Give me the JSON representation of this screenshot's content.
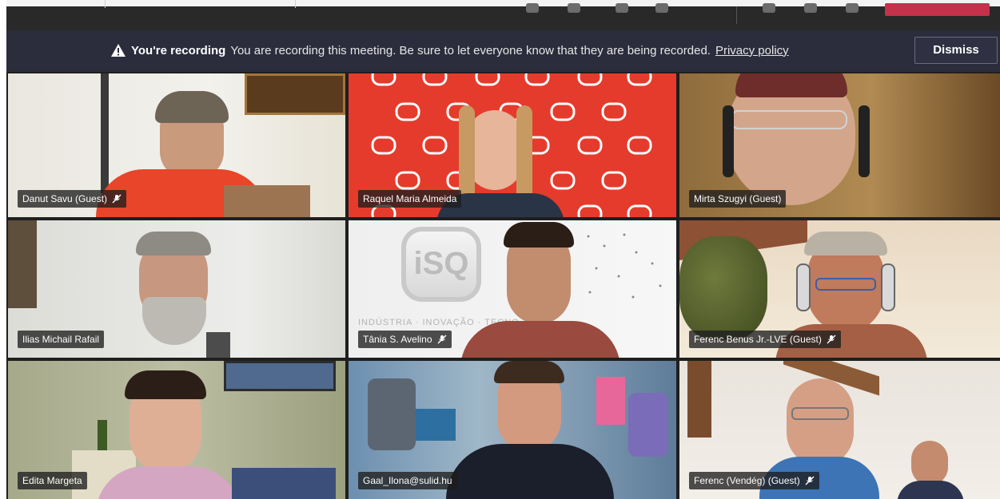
{
  "banner": {
    "recording_title": "You're recording",
    "recording_message": "You are recording this meeting. Be sure to let everyone know that they are being recorded.",
    "privacy_link": "Privacy policy",
    "dismiss_label": "Dismiss"
  },
  "participants": [
    {
      "name": "Danut Savu (Guest)",
      "muted": true
    },
    {
      "name": "Raquel Maria Almeida",
      "muted": false
    },
    {
      "name": "Mirta Szugyi (Guest)",
      "muted": false
    },
    {
      "name": "Ilias Michail Rafail",
      "muted": false
    },
    {
      "name": "Tânia S. Avelino",
      "muted": true
    },
    {
      "name": "Ferenc Benus Jr.-LVE (Guest)",
      "muted": true
    },
    {
      "name": "Edita Margeta",
      "muted": false
    },
    {
      "name": "Gaal_Ilona@sulid.hu",
      "muted": false
    },
    {
      "name": "Ferenc (Vendég) (Guest)",
      "muted": true
    }
  ],
  "background_text": {
    "isq_logo": "iSQ",
    "isq_tagline": "INDÚSTRIA · INOVAÇÃO · TECNO"
  },
  "colors": {
    "banner_bg": "#2b2d3d",
    "isq_red": "#e53b2c",
    "leave_red": "#c4314b"
  }
}
